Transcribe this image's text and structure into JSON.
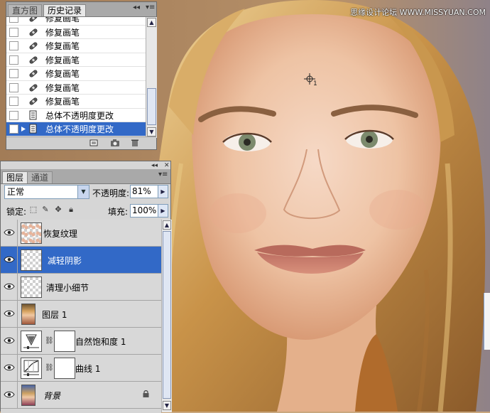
{
  "watermark": "思缘设计论坛 WWW.MISSYUAN.COM",
  "cursor_label": "1",
  "history_panel": {
    "tabs": [
      "直方图",
      "历史记录"
    ],
    "active_tab": 1,
    "items": [
      {
        "label": "修复画笔",
        "icon": "healing-brush-icon",
        "selected": false
      },
      {
        "label": "修复画笔",
        "icon": "healing-brush-icon",
        "selected": false
      },
      {
        "label": "修复画笔",
        "icon": "healing-brush-icon",
        "selected": false
      },
      {
        "label": "修复画笔",
        "icon": "healing-brush-icon",
        "selected": false
      },
      {
        "label": "修复画笔",
        "icon": "healing-brush-icon",
        "selected": false
      },
      {
        "label": "修复画笔",
        "icon": "healing-brush-icon",
        "selected": false
      },
      {
        "label": "修复画笔",
        "icon": "healing-brush-icon",
        "selected": false
      },
      {
        "label": "总体不透明度更改",
        "icon": "history-state-icon",
        "selected": false
      },
      {
        "label": "总体不透明度更改",
        "icon": "history-state-icon",
        "selected": true
      }
    ]
  },
  "layers_panel": {
    "tabs": [
      "图层",
      "通道"
    ],
    "active_tab": 0,
    "blend_mode": "正常",
    "opacity_label": "不透明度:",
    "opacity_value": "81%",
    "lock_label": "锁定:",
    "fill_label": "填充:",
    "fill_value": "100%",
    "layers": [
      {
        "name": "恢复纹理",
        "thumb": "transparent",
        "visible": true,
        "selected": false
      },
      {
        "name": "减轻阴影",
        "thumb": "transparent",
        "visible": true,
        "selected": true
      },
      {
        "name": "清理小细节",
        "thumb": "transparent",
        "visible": true,
        "selected": false
      },
      {
        "name": "图层 1",
        "thumb": "photo",
        "visible": true,
        "selected": false
      },
      {
        "name": "自然饱和度 1",
        "thumb": "vibrance-adjustment",
        "visible": true,
        "selected": false
      },
      {
        "name": "曲线 1",
        "thumb": "curves-adjustment",
        "visible": true,
        "selected": false
      },
      {
        "name": "背景",
        "thumb": "photo",
        "visible": true,
        "selected": false,
        "locked": true
      }
    ]
  },
  "colors": {
    "selection": "#3269c7",
    "panel_bg": "#d6d6d6",
    "tab_bar": "#a9a9a9"
  }
}
